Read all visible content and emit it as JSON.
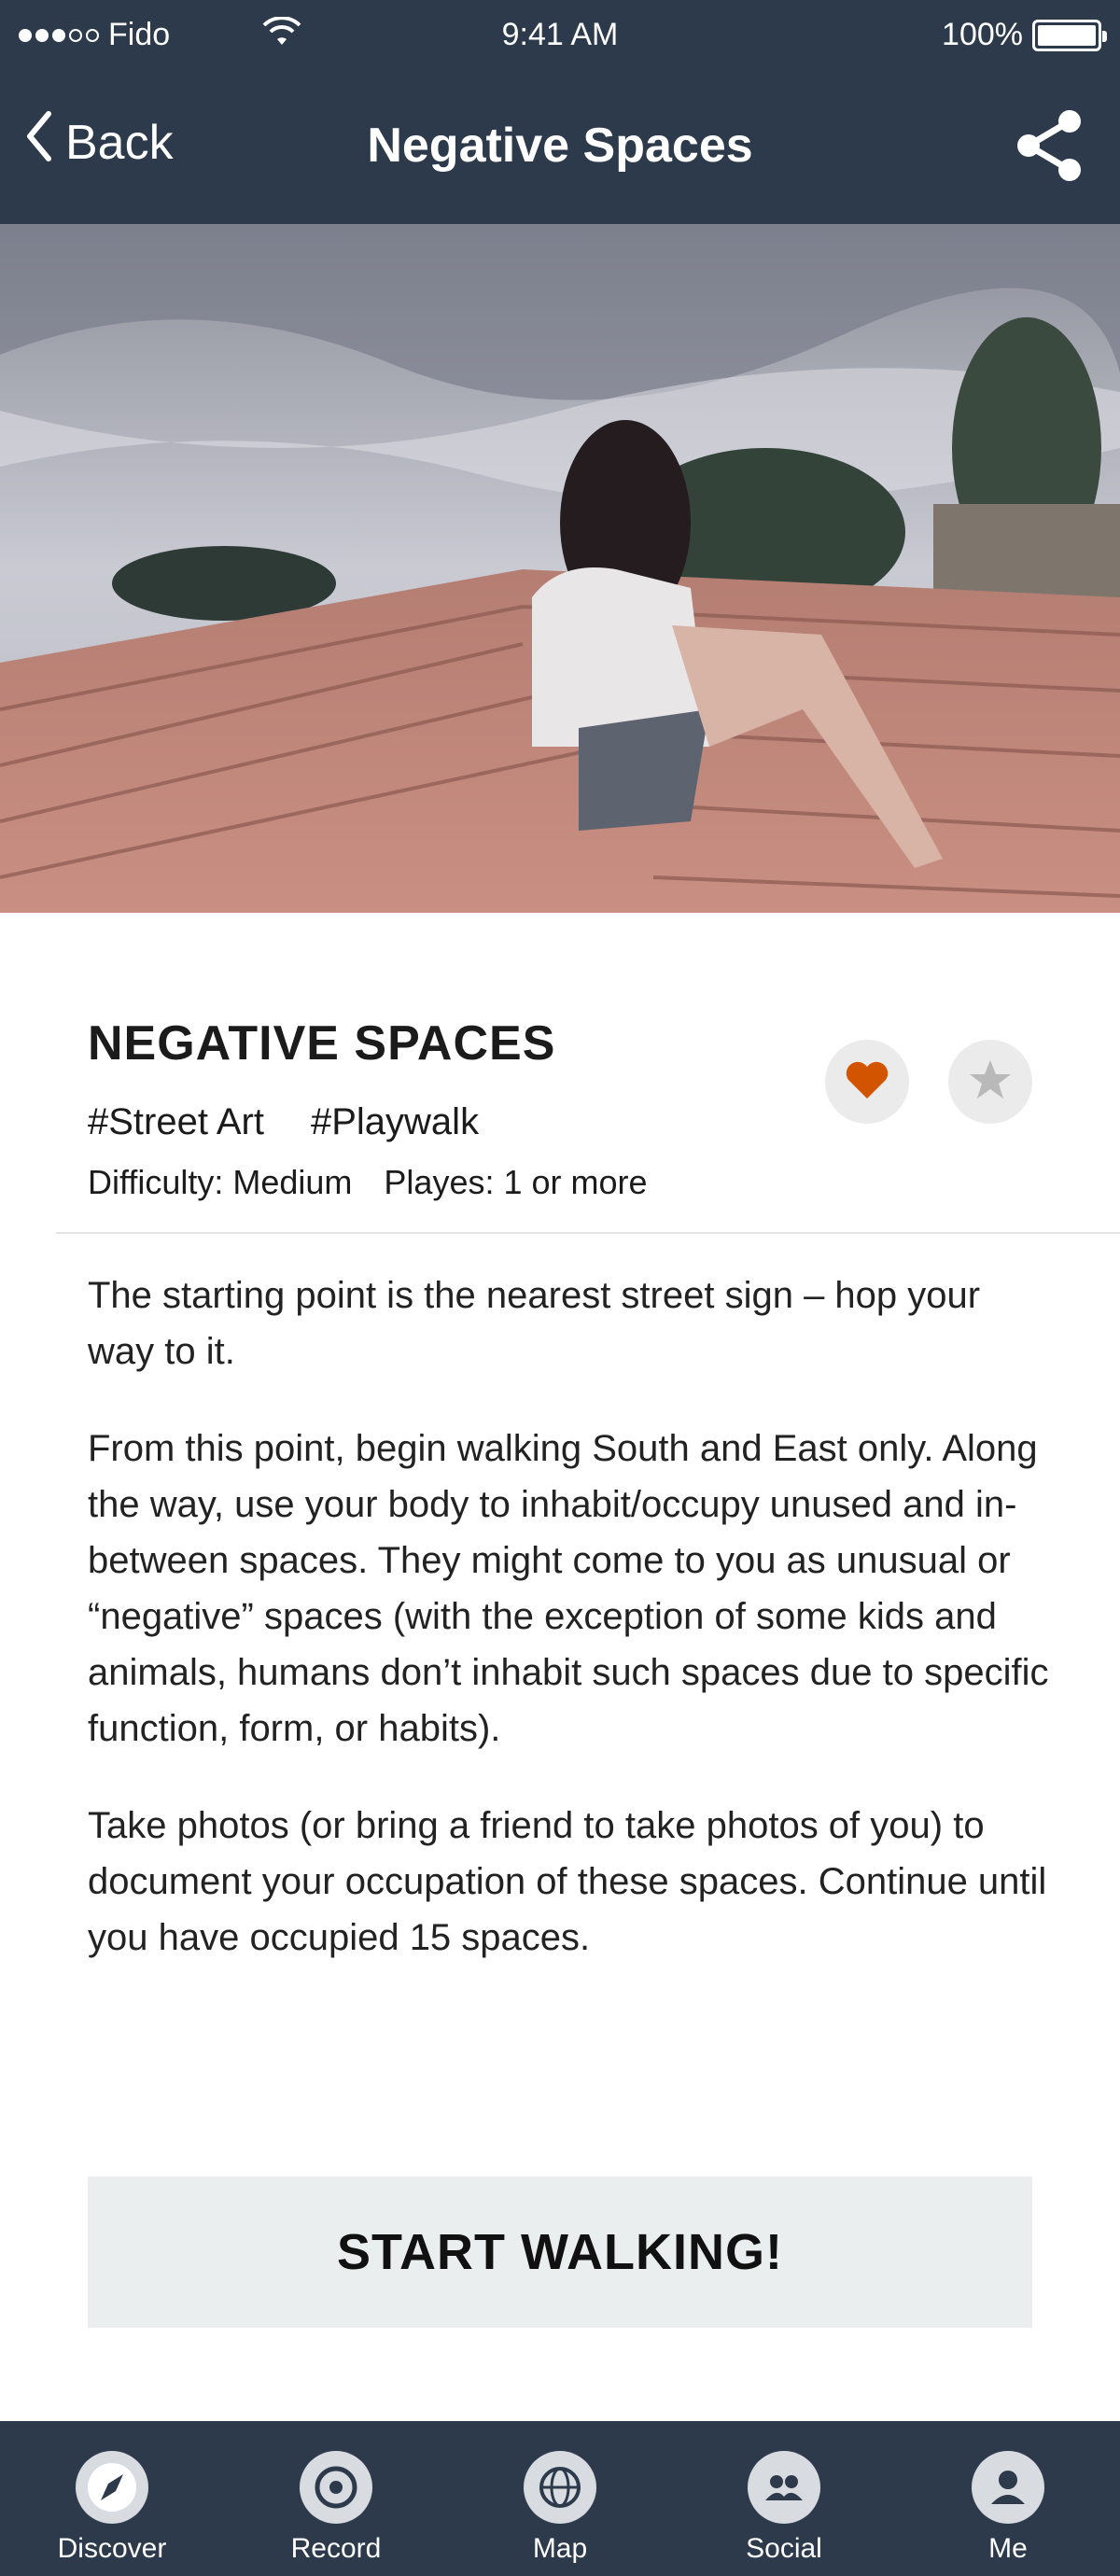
{
  "status_bar": {
    "carrier": "Fido",
    "time": "9:41 AM",
    "battery": "100%",
    "battery_level": 1.0
  },
  "nav": {
    "back_label": "Back",
    "title": "Negative Spaces",
    "share_icon": "share-icon"
  },
  "activity": {
    "title": "NEGATIVE SPACES",
    "tags": [
      "#Street Art",
      "#Playwalk"
    ],
    "difficulty": "Difficulty: Medium",
    "players": "Playes: 1 or more",
    "liked": true,
    "favorited": false
  },
  "description": [
    "The starting point is the nearest street sign – hop your way to it.",
    "From this point, begin walking South and East only. Along the way, use your body to inhabit/occupy unused and in-between spaces. They might come to you as unusual or “negative” spaces (with the exception of some kids and animals, humans don’t inhabit such spaces due to specific function, form, or habits).",
    "Take photos (or bring a friend to take photos of you) to document your occupation of these spaces. Continue until you have occupied 15 spaces."
  ],
  "cta_label": "START WALKING!",
  "tabs": [
    {
      "label": "Discover",
      "icon": "compass-icon"
    },
    {
      "label": "Record",
      "icon": "record-icon"
    },
    {
      "label": "Map",
      "icon": "globe-icon"
    },
    {
      "label": "Social",
      "icon": "people-icon"
    },
    {
      "label": "Me",
      "icon": "user-icon"
    }
  ],
  "colors": {
    "bar_bg": "#2c3a4b",
    "like_accent": "#d35400",
    "cta_bg": "#ebeeef"
  }
}
